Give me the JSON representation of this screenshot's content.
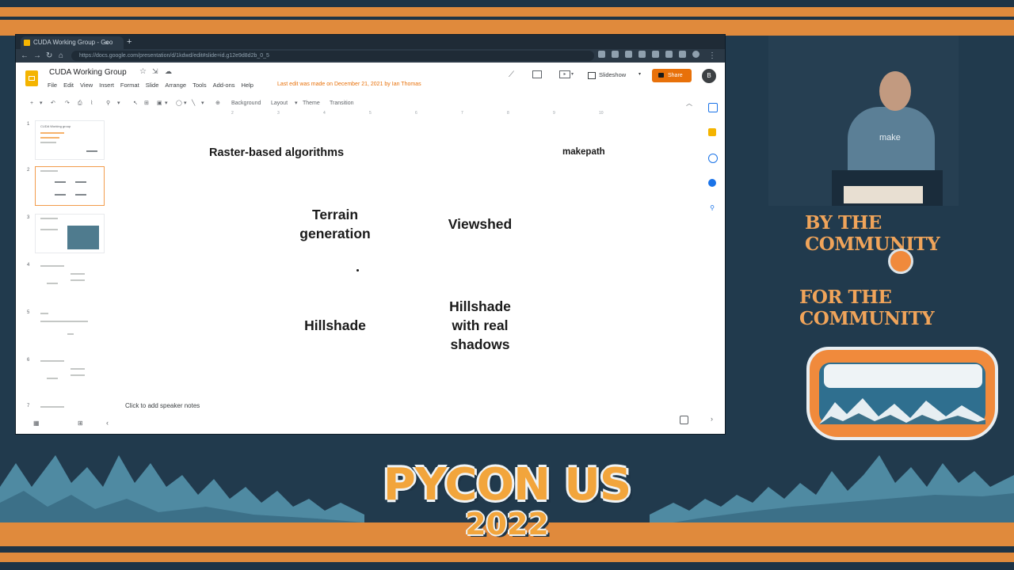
{
  "browser": {
    "tab_title": "CUDA Working Group - Goo",
    "tab_close": "×",
    "new_tab": "+",
    "url": "https://docs.google.com/presentation/d/1kdwd/edit#slide=id.g12e9d8d2b_0_5"
  },
  "docs": {
    "title": "CUDA Working Group",
    "menu": [
      "File",
      "Edit",
      "View",
      "Insert",
      "Format",
      "Slide",
      "Arrange",
      "Tools",
      "Add-ons",
      "Help"
    ],
    "last_edit": "Last edit was made on December 21, 2021 by Ian Thomas",
    "slideshow_label": "Slideshow",
    "share_label": "Share",
    "avatar_initial": "B"
  },
  "toolbar": {
    "background": "Background",
    "layout": "Layout",
    "theme": "Theme",
    "transition": "Transition"
  },
  "ruler": [
    "1",
    "2",
    "3",
    "4",
    "5",
    "6",
    "7",
    "8",
    "9",
    "10"
  ],
  "filmstrip": {
    "numbers": [
      "1",
      "2",
      "3",
      "4",
      "5",
      "6",
      "7"
    ],
    "slide1_title": "CUDA Working group"
  },
  "slide": {
    "title": "Raster-based algorithms",
    "logo_make": "make",
    "logo_path": "path",
    "cells": {
      "terrain_line1": "Terrain",
      "terrain_line2": "generation",
      "viewshed": "Viewshed",
      "hillshade": "Hillshade",
      "shadows_line1": "Hillshade",
      "shadows_line2": "with real",
      "shadows_line3": "shadows"
    }
  },
  "speaker_notes": "Click to add speaker notes",
  "event": {
    "by_community": "BY THE COMMUNITY",
    "for_community": "FOR THE COMMUNITY",
    "conference": "PYCON US",
    "year": "2022",
    "shirt_text": "make"
  },
  "colors": {
    "accent_orange": "#e08a3c",
    "navy": "#1e3446",
    "share_button": "#e8710a"
  }
}
